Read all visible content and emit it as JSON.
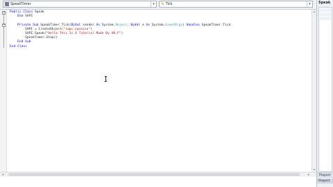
{
  "dropdowns": {
    "object": "SpeakTimer",
    "event": "Tick"
  },
  "code_lines": [
    {
      "parts": [
        {
          "t": "Public Class",
          "c": "kw"
        },
        {
          "t": " Speak",
          "c": ""
        }
      ]
    },
    {
      "parts": [
        {
          "t": "    Dim",
          "c": "kw"
        },
        {
          "t": " SAPI",
          "c": ""
        }
      ]
    },
    {
      "parts": [
        {
          "t": "",
          "c": ""
        }
      ]
    },
    {
      "parts": [
        {
          "t": "    Private Sub",
          "c": "kw"
        },
        {
          "t": " SpeakTimer_Tick(",
          "c": ""
        },
        {
          "t": "ByVal",
          "c": "kw"
        },
        {
          "t": " sender ",
          "c": ""
        },
        {
          "t": "As",
          "c": "kw"
        },
        {
          "t": " System.",
          "c": ""
        },
        {
          "t": "Object",
          "c": "typ"
        },
        {
          "t": ", ",
          "c": ""
        },
        {
          "t": "ByVal",
          "c": "kw"
        },
        {
          "t": " e ",
          "c": ""
        },
        {
          "t": "As",
          "c": "kw"
        },
        {
          "t": " System.",
          "c": ""
        },
        {
          "t": "EventArgs",
          "c": "typ"
        },
        {
          "t": ") ",
          "c": ""
        },
        {
          "t": "Handles",
          "c": "kw"
        },
        {
          "t": " SpeakTimer.Tick",
          "c": ""
        }
      ]
    },
    {
      "parts": [
        {
          "t": "        SAPI = CreateObject(",
          "c": ""
        },
        {
          "t": "\"sapi.spvoice\"",
          "c": "str"
        },
        {
          "t": ")",
          "c": ""
        }
      ]
    },
    {
      "parts": [
        {
          "t": "        SAPI.Speak(",
          "c": ""
        },
        {
          "t": "\"Hello This Is A Tutorial Made By VB.F\"",
          "c": "str"
        },
        {
          "t": ")",
          "c": ""
        }
      ]
    },
    {
      "parts": [
        {
          "t": "        SpeakTimer.Stop()",
          "c": ""
        }
      ]
    },
    {
      "parts": [
        {
          "t": "    End Sub",
          "c": "kw"
        }
      ]
    },
    {
      "parts": [
        {
          "t": "End Class",
          "c": "kw"
        }
      ]
    }
  ],
  "right_panel": {
    "title": "Speak",
    "footer": "Propert",
    "tab": "Propert"
  },
  "colors": {
    "keyword": "#0000d0",
    "string": "#a31515",
    "type": "#2b91af"
  }
}
